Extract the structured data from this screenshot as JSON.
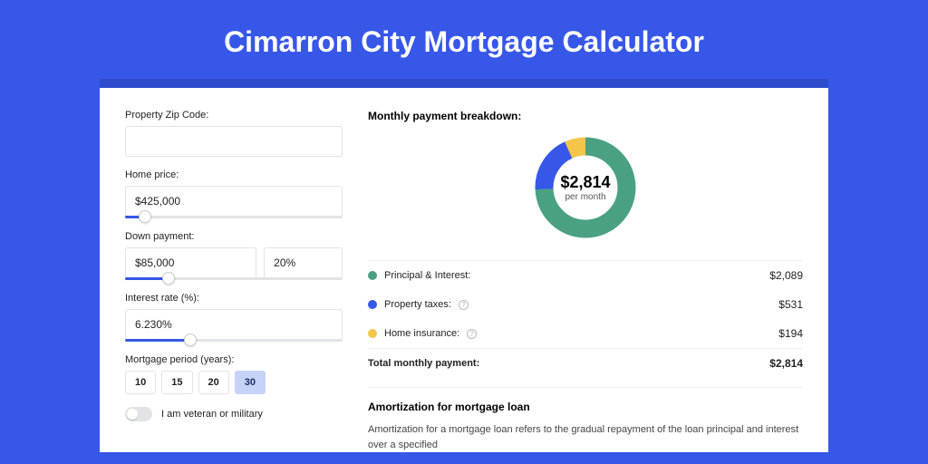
{
  "title": "Cimarron City Mortgage Calculator",
  "form": {
    "zip_label": "Property Zip Code:",
    "zip_value": "",
    "home_price_label": "Home price:",
    "home_price_value": "$425,000",
    "home_price_slider_pct": 9,
    "down_payment_label": "Down payment:",
    "down_payment_value": "$85,000",
    "down_payment_pct_value": "20%",
    "down_payment_slider_pct": 20,
    "interest_label": "Interest rate (%):",
    "interest_value": "6.230%",
    "interest_slider_pct": 30,
    "period_label": "Mortgage period (years):",
    "periods": [
      "10",
      "15",
      "20",
      "30"
    ],
    "period_selected": "30",
    "veteran_label": "I am veteran or military",
    "veteran_on": false
  },
  "breakdown": {
    "title": "Monthly payment breakdown:",
    "center_amount": "$2,814",
    "center_sub": "per month",
    "items": [
      {
        "label": "Principal & Interest:",
        "value": "$2,089",
        "color": "#49A181",
        "info": false
      },
      {
        "label": "Property taxes:",
        "value": "$531",
        "color": "#3657E8",
        "info": true
      },
      {
        "label": "Home insurance:",
        "value": "$194",
        "color": "#F4C549",
        "info": true
      }
    ],
    "total_label": "Total monthly payment:",
    "total_value": "$2,814"
  },
  "chart_data": {
    "type": "pie",
    "title": "Monthly payment breakdown",
    "series": [
      {
        "name": "Principal & Interest",
        "value": 2089,
        "color": "#49A181"
      },
      {
        "name": "Property taxes",
        "value": 531,
        "color": "#3657E8"
      },
      {
        "name": "Home insurance",
        "value": 194,
        "color": "#F4C549"
      }
    ],
    "total": 2814,
    "center_label": "$2,814 per month"
  },
  "amort": {
    "title": "Amortization for mortgage loan",
    "text": "Amortization for a mortgage loan refers to the gradual repayment of the loan principal and interest over a specified"
  }
}
